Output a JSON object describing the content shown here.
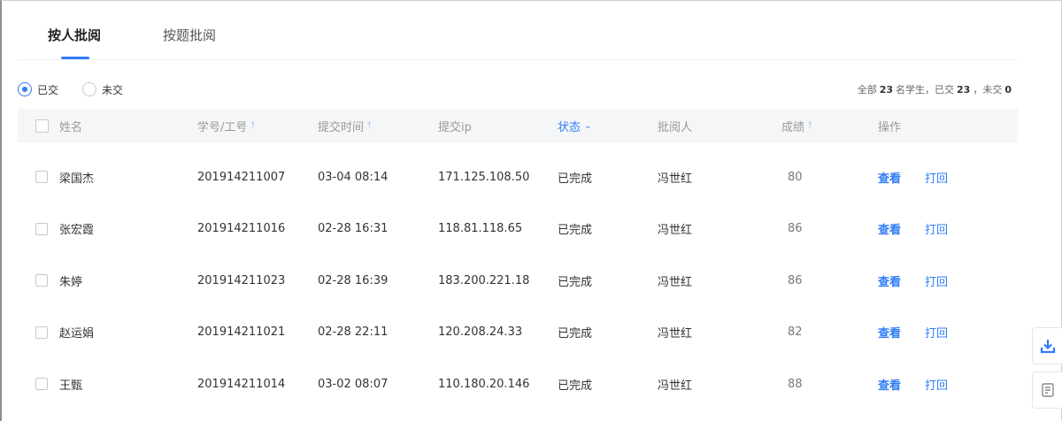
{
  "tabs": [
    {
      "label": "按人批阅",
      "active": true
    },
    {
      "label": "按题批阅",
      "active": false
    }
  ],
  "filter": {
    "options": [
      {
        "label": "已交",
        "checked": true
      },
      {
        "label": "未交",
        "checked": false
      }
    ]
  },
  "summary": {
    "prefix": "全部",
    "total": "23",
    "mid": "名学生，已交",
    "submitted": "23",
    "mid2": "，未交",
    "unsubmitted": "0"
  },
  "table": {
    "headers": {
      "name": "姓名",
      "id": "学号/工号",
      "time": "提交时间",
      "ip": "提交ip",
      "status": "状态",
      "reviewer": "批阅人",
      "score": "成绩",
      "ops": "操作"
    },
    "rows": [
      {
        "name": "梁国杰",
        "id": "201914211007",
        "time": "03-04 08:14",
        "ip": "171.125.108.50",
        "status": "已完成",
        "reviewer": "冯世红",
        "score": "80",
        "view": "查看",
        "return": "打回"
      },
      {
        "name": "张宏霞",
        "id": "201914211016",
        "time": "02-28 16:31",
        "ip": "118.81.118.65",
        "status": "已完成",
        "reviewer": "冯世红",
        "score": "86",
        "view": "查看",
        "return": "打回"
      },
      {
        "name": "朱婷",
        "id": "201914211023",
        "time": "02-28 16:39",
        "ip": "183.200.221.18",
        "status": "已完成",
        "reviewer": "冯世红",
        "score": "86",
        "view": "查看",
        "return": "打回"
      },
      {
        "name": "赵运娟",
        "id": "201914211021",
        "time": "02-28 22:11",
        "ip": "120.208.24.33",
        "status": "已完成",
        "reviewer": "冯世红",
        "score": "82",
        "view": "查看",
        "return": "打回"
      },
      {
        "name": "王甄",
        "id": "201914211014",
        "time": "03-02 08:07",
        "ip": "110.180.20.146",
        "status": "已完成",
        "reviewer": "冯世红",
        "score": "88",
        "view": "查看",
        "return": "打回"
      }
    ]
  },
  "colors": {
    "accent": "#2f7cf6",
    "header_bg": "#f5f6f8"
  },
  "icons": {
    "side_1": "download-icon",
    "side_2": "feedback-icon"
  }
}
